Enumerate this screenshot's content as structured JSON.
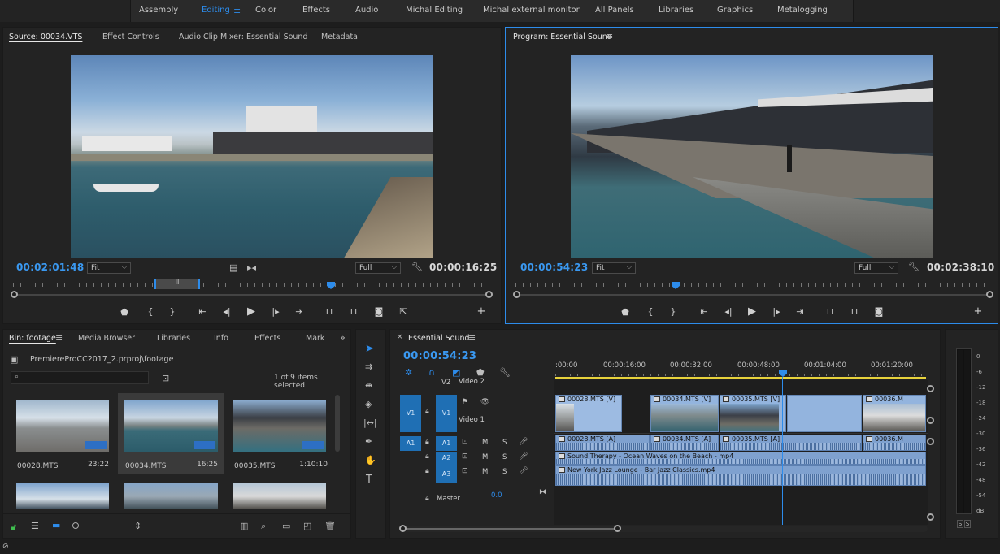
{
  "workspaces": [
    "Assembly",
    "Editing",
    "Color",
    "Effects",
    "Audio",
    "Michal Editing",
    "Michal external monitor",
    "All Panels",
    "Libraries",
    "Graphics",
    "Metalogging"
  ],
  "active_workspace": "Editing",
  "source": {
    "tabs": [
      "Source: 00034.VTS",
      "Effect Controls",
      "Audio Clip Mixer: Essential Sound",
      "Metadata"
    ],
    "timecode_left": "00:02:01:48",
    "fit": "Fit",
    "quality": "Full",
    "timecode_right": "00:00:16:25",
    "in_out_marker": "II"
  },
  "program": {
    "title": "Program: Essential Sound",
    "timecode_left": "00:00:54:23",
    "fit": "Fit",
    "quality": "Full",
    "timecode_right": "00:02:38:10"
  },
  "project": {
    "tabs": [
      "Bin: footage",
      "Media Browser",
      "Libraries",
      "Info",
      "Effects",
      "Mark"
    ],
    "path": "PremiereProCC2017_2.prproj\\footage",
    "selected": "1 of 9 items selected",
    "items": [
      {
        "name": "00028.MTS",
        "duration": "23:22"
      },
      {
        "name": "00034.MTS",
        "duration": "16:25"
      },
      {
        "name": "00035.MTS",
        "duration": "1:10:10"
      }
    ]
  },
  "timeline": {
    "tab": "Essential Sound",
    "timecode": "00:00:54:23",
    "ruler": [
      ":00:00",
      "00:00:16:00",
      "00:00:32:00",
      "00:00:48:00",
      "00:01:04:00",
      "00:01:20:00"
    ],
    "tracks": {
      "v2": "V2",
      "v2_name": "Video 2",
      "v1": "V1",
      "v1_src": "V1",
      "v1_name": "Video 1",
      "a1_src": "A1",
      "a1": "A1",
      "a2": "A2",
      "a3": "A3",
      "m": "M",
      "s": "S",
      "master": "Master",
      "master_val": "0.0"
    },
    "video_clips": [
      "00028.MTS [V]",
      "00034.MTS [V]",
      "00035.MTS [V]",
      "00036.M"
    ],
    "audio_clips_a1": [
      "00028.MTS [A]",
      "00034.MTS [A]",
      "00035.MTS [A]",
      "00036.M"
    ],
    "a2_clip": "Sound Therapy - Ocean Waves on the Beach - mp4",
    "a3_clip": "New York Jazz Lounge - Bar Jazz Classics.mp4"
  },
  "meter": {
    "scale": [
      "0",
      "-6",
      "-12",
      "-18",
      "-24",
      "-30",
      "-36",
      "-42",
      "-48",
      "-54",
      "dB"
    ],
    "solo": [
      "S",
      "S"
    ]
  },
  "colors": {
    "accent": "#2d8ceb",
    "panel": "#232323",
    "clip_video": "#93b4de",
    "clip_audio": "#7fa1cf"
  }
}
